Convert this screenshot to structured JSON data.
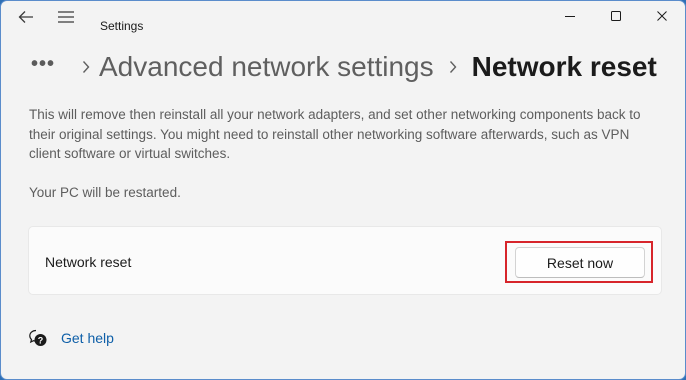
{
  "window": {
    "title": "Settings"
  },
  "titlebar": {
    "icons": {
      "back": "back-arrow-icon",
      "menu": "hamburger-menu-icon",
      "minimize": "minimize-icon",
      "maximize": "maximize-icon",
      "close": "close-icon"
    }
  },
  "breadcrumb": {
    "overflow": "•••",
    "parent": "Advanced network settings",
    "current": "Network reset"
  },
  "content": {
    "description": "This will remove then reinstall all your network adapters, and set other networking components back to their original settings. You might need to reinstall other networking software afterwards, such as VPN client software or virtual switches.",
    "restart_note": "Your PC will be restarted.",
    "card": {
      "label": "Network reset",
      "button_label": "Reset now"
    },
    "help": {
      "icon": "help-chat-icon",
      "label": "Get help"
    }
  },
  "colors": {
    "window_bg": "#f3f3f3",
    "card_bg": "#fbfbfb",
    "link": "#0e5fa8",
    "highlight": "#d7252b"
  }
}
